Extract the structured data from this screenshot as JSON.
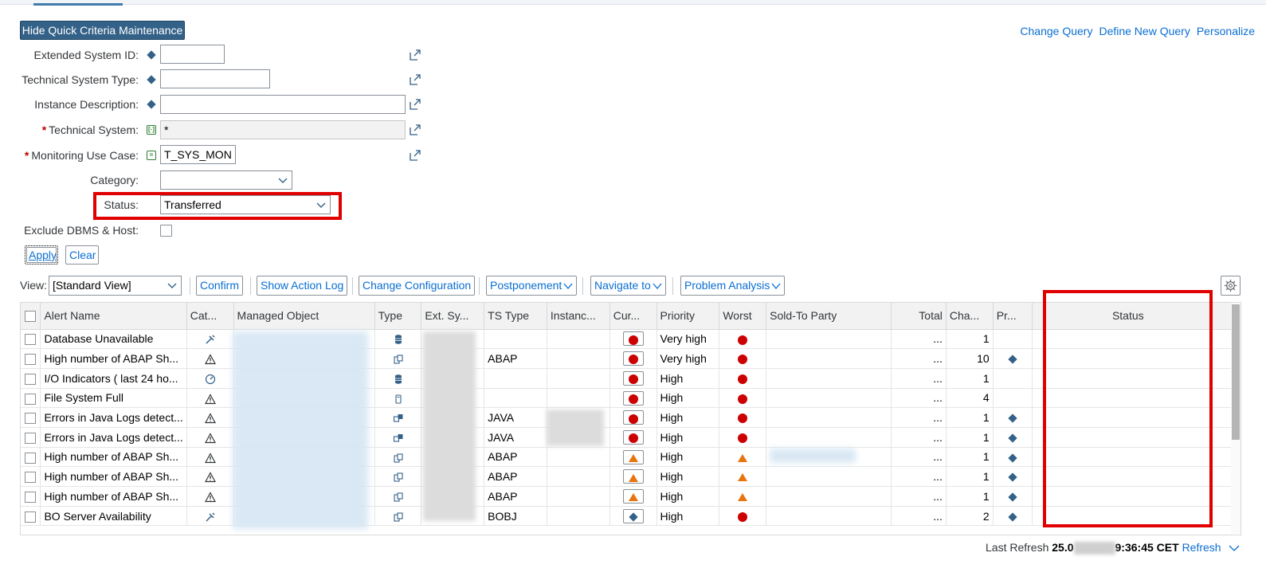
{
  "header": {
    "hide_criteria_label": "Hide Quick Criteria Maintenance",
    "links": [
      "Change Query",
      "Define New Query",
      "Personalize"
    ]
  },
  "criteria": {
    "extended_system_id": {
      "label": "Extended System ID:",
      "value": ""
    },
    "technical_system_type": {
      "label": "Technical System Type:",
      "value": ""
    },
    "instance_description": {
      "label": "Instance Description:",
      "value": ""
    },
    "technical_system": {
      "label": "Technical System:",
      "value": "*"
    },
    "monitoring_use_case": {
      "label": "Monitoring Use Case:",
      "value": "T_SYS_MON"
    },
    "category": {
      "label": "Category:",
      "value": ""
    },
    "status": {
      "label": "Status:",
      "value": "Transferred"
    },
    "exclude_dbms": {
      "label": "Exclude DBMS & Host:"
    },
    "required_mark": "*"
  },
  "actions": {
    "apply": "Apply",
    "clear": "Clear"
  },
  "toolbar": {
    "view_label": "View:",
    "view_value": "[Standard View]",
    "buttons": [
      "Confirm",
      "Show Action Log",
      "Change Configuration",
      "Postponement",
      "Navigate to",
      "Problem Analysis"
    ]
  },
  "table": {
    "columns": [
      "Alert Name",
      "Cat...",
      "Managed Object",
      "Type",
      "Ext. Sy...",
      "TS Type",
      "Instanc...",
      "Cur...",
      "Priority",
      "Worst",
      "Sold-To Party",
      "Total",
      "Cha...",
      "Pr...",
      "Status"
    ],
    "rows": [
      {
        "name": "Database Unavailable",
        "cat": "availability-icon",
        "type": "database-icon",
        "ts_type": "",
        "cur": "red",
        "priority": "Very high",
        "worst": "red",
        "total": "...",
        "changes": "1",
        "pr": ""
      },
      {
        "name": "High number of ABAP Sh...",
        "cat": "alert-icon",
        "type": "system-icon",
        "ts_type": "ABAP",
        "cur": "red",
        "priority": "Very high",
        "worst": "red",
        "total": "...",
        "changes": "10",
        "pr": "diamond"
      },
      {
        "name": "I/O Indicators ( last 24 ho...",
        "cat": "performance-icon",
        "type": "database-icon",
        "ts_type": "",
        "cur": "red",
        "priority": "High",
        "worst": "red",
        "total": "...",
        "changes": "1",
        "pr": ""
      },
      {
        "name": "File System Full",
        "cat": "alert-icon",
        "type": "host-icon",
        "ts_type": "",
        "cur": "red",
        "priority": "High",
        "worst": "red",
        "total": "...",
        "changes": "4",
        "pr": ""
      },
      {
        "name": "Errors in Java Logs detect...",
        "cat": "alert-icon",
        "type": "instance-icon",
        "ts_type": "JAVA",
        "cur": "red",
        "priority": "High",
        "worst": "red",
        "total": "...",
        "changes": "1",
        "pr": "diamond"
      },
      {
        "name": "Errors in Java Logs detect...",
        "cat": "alert-icon",
        "type": "instance-icon",
        "ts_type": "JAVA",
        "cur": "red",
        "priority": "High",
        "worst": "red",
        "total": "...",
        "changes": "1",
        "pr": "diamond"
      },
      {
        "name": "High number of ABAP Sh...",
        "cat": "alert-icon",
        "type": "system-icon",
        "ts_type": "ABAP",
        "cur": "yellow",
        "priority": "High",
        "worst": "yellow",
        "total": "...",
        "changes": "1",
        "pr": "diamond"
      },
      {
        "name": "High number of ABAP Sh...",
        "cat": "alert-icon",
        "type": "system-icon",
        "ts_type": "ABAP",
        "cur": "yellow",
        "priority": "High",
        "worst": "yellow",
        "total": "...",
        "changes": "1",
        "pr": "diamond"
      },
      {
        "name": "High number of ABAP Sh...",
        "cat": "alert-icon",
        "type": "system-icon",
        "ts_type": "ABAP",
        "cur": "yellow",
        "priority": "High",
        "worst": "yellow",
        "total": "...",
        "changes": "1",
        "pr": "diamond"
      },
      {
        "name": "BO Server Availability",
        "cat": "availability-icon",
        "type": "system-icon",
        "ts_type": "BOBJ",
        "cur": "diamond",
        "priority": "High",
        "worst": "red",
        "total": "...",
        "changes": "2",
        "pr": "diamond"
      }
    ]
  },
  "footer": {
    "last_refresh_label": "Last Refresh",
    "date_prefix": "25.0",
    "time_suffix": "9:36:45 CET",
    "refresh_link": "Refresh"
  },
  "colors": {
    "accent": "#0a6ed1",
    "primary_button": "#346187",
    "error": "#cc0000",
    "warning": "#e9730c",
    "highlight_box": "#e00000"
  }
}
